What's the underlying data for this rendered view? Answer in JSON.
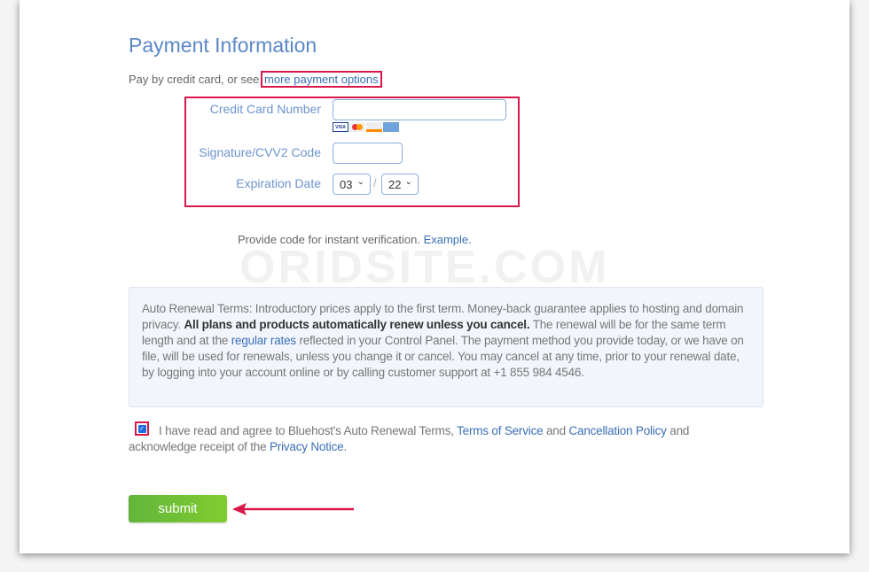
{
  "watermark": "ORIDSITE.COM",
  "title": "Payment Information",
  "intro": {
    "text": "Pay by credit card, or see ",
    "link": "more payment options"
  },
  "form": {
    "card_number_label": "Credit Card Number",
    "card_number_value": "",
    "card_logos": [
      "VISA",
      "MC",
      "DISCOVER",
      "AMEX"
    ],
    "cvv_label": "Signature/CVV2 Code",
    "cvv_value": "",
    "expiration_label": "Expiration Date",
    "exp_month": "03",
    "exp_separator": "/",
    "exp_year": "22"
  },
  "verify": {
    "text": "Provide code for instant verification. ",
    "link": "Example."
  },
  "terms": {
    "part1": "Auto Renewal Terms: Introductory prices apply to the first term. Money-back guarantee applies to hosting and domain privacy. ",
    "bold": "All plans and products automatically renew unless you cancel.",
    "part2": " The renewal will be for the same term length and at the ",
    "link": "regular rates",
    "part3": " reflected in your Control Panel. The payment method you provide today, or we have on file, will be used for renewals, unless you change it or cancel. You may cancel at any time, prior to your renewal date, by logging into your account online or by calling customer support at +1 855 984 4546."
  },
  "agree": {
    "checked": true,
    "text1": "I have read and agree to Bluehost's Auto Renewal Terms, ",
    "tos": "Terms of Service",
    "and": " and ",
    "cancel": "Cancellation Policy",
    "text2": " and acknowledge receipt of the ",
    "privacy": "Privacy Notice",
    "end": "."
  },
  "submit_label": "submit",
  "colors": {
    "accent": "#5b87c7",
    "highlight": "#d8184a",
    "submit": "#6fbf35"
  }
}
